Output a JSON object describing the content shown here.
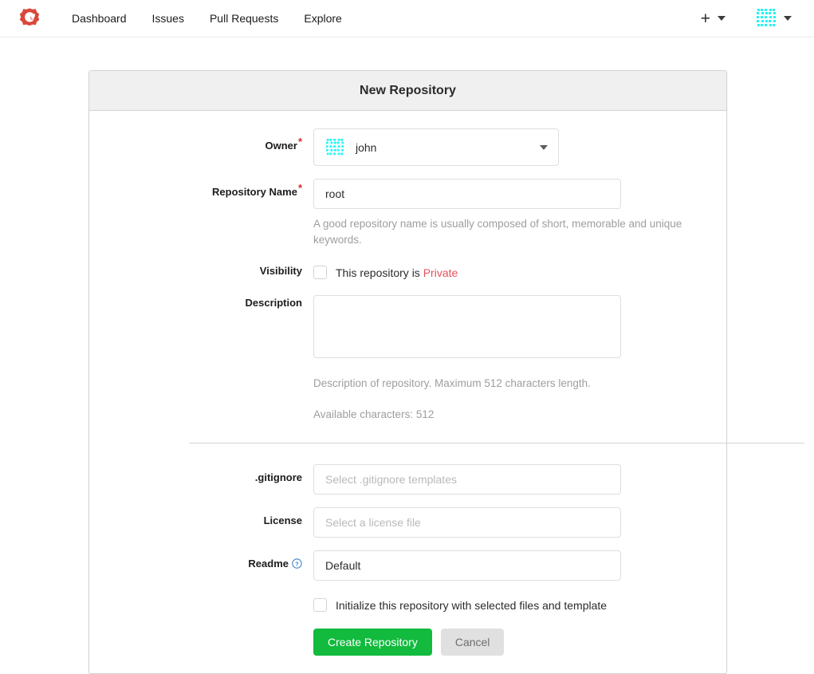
{
  "navbar": {
    "logo_icon": "gitea-logo-icon",
    "links": [
      {
        "label": "Dashboard"
      },
      {
        "label": "Issues"
      },
      {
        "label": "Pull Requests"
      },
      {
        "label": "Explore"
      }
    ],
    "create_icon": "plus-icon",
    "create_caret_icon": "chevron-down-icon",
    "avatar_icon": "user-identicon-avatar",
    "user_caret_icon": "chevron-down-icon",
    "colors": {
      "logo_red": "#d9483b",
      "avatar_cyan": "#25f4f4"
    }
  },
  "form": {
    "title": "New Repository",
    "owner": {
      "label": "Owner",
      "required_marker": "*",
      "value": "john",
      "avatar_icon": "owner-identicon-avatar",
      "caret_icon": "dropdown-caret-icon"
    },
    "repo_name": {
      "label": "Repository Name",
      "required_marker": "*",
      "value": "root",
      "placeholder": "",
      "help": "A good repository name is usually composed of short, memorable and unique keywords."
    },
    "visibility": {
      "label": "Visibility",
      "checkbox_checked": false,
      "text_prefix": "This repository is ",
      "text_private": "Private"
    },
    "description": {
      "label": "Description",
      "value": "",
      "placeholder": "",
      "help": "Description of repository. Maximum 512 characters length.",
      "available": "Available characters: 512"
    },
    "gitignore": {
      "label": ".gitignore",
      "value": "",
      "placeholder": "Select .gitignore templates"
    },
    "license": {
      "label": "License",
      "value": "",
      "placeholder": "Select a license file"
    },
    "readme": {
      "label": "Readme",
      "help_icon": "help-question-circle-icon",
      "value": "Default",
      "placeholder": ""
    },
    "initialize": {
      "checkbox_checked": false,
      "label": "Initialize this repository with selected files and template"
    },
    "buttons": {
      "create": "Create Repository",
      "cancel": "Cancel"
    },
    "colors": {
      "create_green": "#12ba3e",
      "cancel_gray": "#e0e0e0",
      "required_red": "#db2828",
      "private_red": "#e8505b",
      "help_blue": "#4183c4"
    }
  }
}
